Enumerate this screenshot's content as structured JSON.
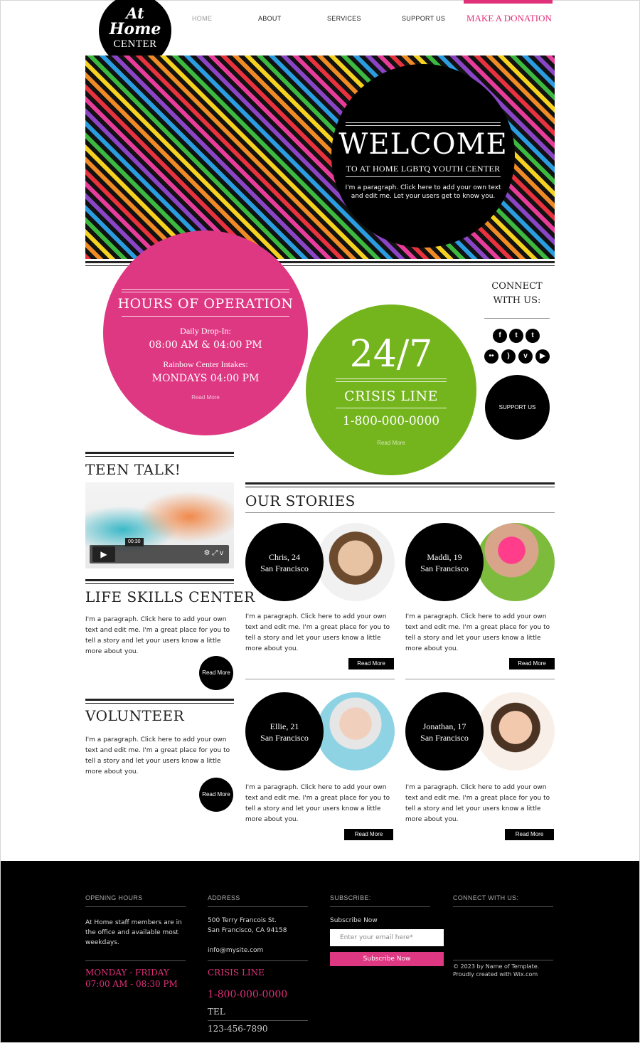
{
  "logo": {
    "line1": "At",
    "line2": "Home",
    "line3": "CENTER"
  },
  "nav": {
    "home": "HOME",
    "about": "ABOUT",
    "services": "SERVICES",
    "support": "SUPPORT US",
    "donate": "MAKE A DONATION"
  },
  "hero": {
    "title": "WELCOME",
    "subtitle": "TO AT HOME LGBTQ YOUTH CENTER",
    "text": "I'm a paragraph. Click here to add your own text and edit me. Let your users get to know you."
  },
  "hours": {
    "title": "HOURS OF OPERATION",
    "dropin_label": "Daily Drop-In:",
    "dropin_value": "08:00 AM & 04:00 PM",
    "intake_label": "Rainbow Center Intakes:",
    "intake_value": "MONDAYS 04:00 PM",
    "read_more": "Read More"
  },
  "crisis": {
    "big": "24/7",
    "label": "CRISIS LINE",
    "phone": "1-800-000-0000",
    "read_more": "Read More"
  },
  "connect": {
    "line1": "CONNECT",
    "line2": "WITH US:",
    "support": "SUPPORT US"
  },
  "social_icons": [
    "facebook-icon",
    "twitter-icon",
    "tumblr-icon",
    "flickr-icon",
    "rss-icon",
    "vimeo-icon",
    "youtube-icon"
  ],
  "teen_talk": {
    "title": "TEEN TALK!",
    "time": "00:30"
  },
  "life_skills": {
    "title": "LIFE SKILLS CENTER",
    "text": "I'm a paragraph. Click here to add your own text and edit me. I'm a great place for you to tell a story and let your users know a little more about you.",
    "button": "Read More"
  },
  "volunteer": {
    "title": "VOLUNTEER",
    "text": "I'm a paragraph. Click here to add your own text and edit me. I'm a great place for you to tell a story and let your users know a little more about you.",
    "button": "Read More"
  },
  "stories": {
    "title": "OUR STORIES",
    "items": [
      {
        "name": "Chris, 24",
        "city": "San Francisco",
        "text": "I'm a paragraph. Click here to add your own text and edit me. I'm a great place for you to tell a story and let your users know a little more about you.",
        "button": "Read More"
      },
      {
        "name": "Maddi, 19",
        "city": "San Francisco",
        "text": "I'm a paragraph. Click here to add your own text and edit me. I'm a great place for you to tell a story and let your users know a little more about you.",
        "button": "Read More"
      },
      {
        "name": "Ellie, 21",
        "city": "San Francisco",
        "text": "I'm a paragraph. Click here to add your own text and edit me. I'm a great place for you to tell a story and let your users know a little more about you.",
        "button": "Read More"
      },
      {
        "name": "Jonathan, 17",
        "city": "San Francisco",
        "text": "I'm a paragraph. Click here to add your own text and edit me. I'm a great place for you to tell a story and let your users know a little more about you.",
        "button": "Read More"
      }
    ]
  },
  "footer": {
    "hours_title": "OPENING HOURS",
    "hours_text": "At Home staff members are in the office and available most weekdays.",
    "days": "MONDAY - FRIDAY",
    "times": "07:00 AM - 08:30 PM",
    "address_title": "ADDRESS",
    "address1": "500 Terry Francois St.",
    "address2": "San Francisco, CA 94158",
    "email": "info@mysite.com",
    "crisis_label": "CRISIS LINE",
    "crisis_phone": "1-800-000-0000",
    "tel_label": "TEL",
    "tel": "123-456-7890",
    "subscribe_title": "SUBSCRIBE:",
    "subscribe_label": "Subscribe Now",
    "email_placeholder": "Enter your email here*",
    "subscribe_button": "Subscribe Now",
    "connect_title": "CONNECT WITH US:",
    "copyright1": "© 2023 by Name of Template.",
    "copyright2": "Proudly created with Wix.com"
  },
  "colors": {
    "pink": "#de3883",
    "green": "#74b51e",
    "black": "#000000"
  }
}
